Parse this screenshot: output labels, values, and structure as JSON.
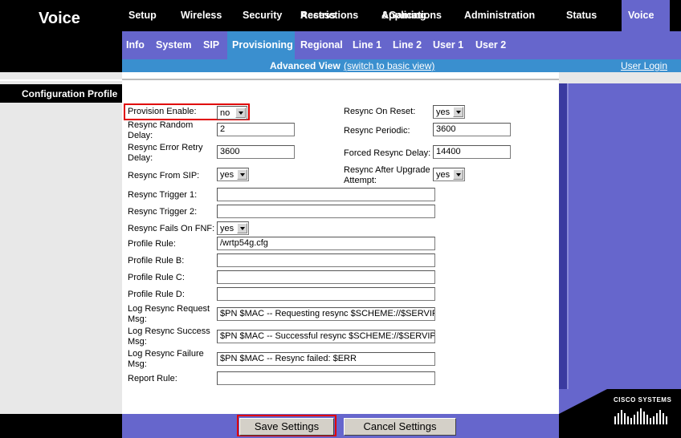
{
  "app": {
    "title": "Voice"
  },
  "main_nav": {
    "tabs": [
      {
        "label": "Setup"
      },
      {
        "label": "Wireless"
      },
      {
        "label": "Security"
      },
      {
        "label": "Access Restrictions",
        "line1": "Access",
        "line2": "Restrictions"
      },
      {
        "label": "Applications &Gaming",
        "line1": "Applications",
        "line2": "&Gaming"
      },
      {
        "label": "Administration"
      },
      {
        "label": "Status"
      },
      {
        "label": "Voice"
      }
    ],
    "active": "Voice"
  },
  "sub_nav": {
    "tabs": [
      "Info",
      "System",
      "SIP",
      "Provisioning",
      "Regional",
      "Line 1",
      "Line 2",
      "User 1",
      "User 2"
    ],
    "active": "Provisioning"
  },
  "view_bar": {
    "advanced_label": "Advanced View",
    "switch_link": "(switch to basic view)",
    "login_link": "User Login"
  },
  "section": {
    "title": "Configuration Profile"
  },
  "form": {
    "provision_enable": {
      "label": "Provision Enable:",
      "value": "no"
    },
    "resync_random_delay": {
      "label_line1": "Resync Random",
      "label_line2": "Delay:",
      "value": "2"
    },
    "resync_error_retry_delay": {
      "label_line1": "Resync Error Retry",
      "label_line2": "Delay:",
      "value": "3600"
    },
    "resync_from_sip": {
      "label": "Resync From SIP:",
      "value": "yes"
    },
    "resync_trigger_1": {
      "label": "Resync Trigger 1:",
      "value": ""
    },
    "resync_trigger_2": {
      "label": "Resync Trigger 2:",
      "value": ""
    },
    "resync_fails_on_fnf": {
      "label": "Resync Fails On FNF:",
      "value": "yes"
    },
    "profile_rule": {
      "label": "Profile Rule:",
      "value": "/wrtp54g.cfg"
    },
    "profile_rule_b": {
      "label": "Profile Rule B:",
      "value": ""
    },
    "profile_rule_c": {
      "label": "Profile Rule C:",
      "value": ""
    },
    "profile_rule_d": {
      "label": "Profile Rule D:",
      "value": ""
    },
    "log_resync_request_msg": {
      "label_line1": "Log Resync Request",
      "label_line2": "Msg:",
      "value": "$PN $MAC -- Requesting resync $SCHEME://$SERVIP:"
    },
    "log_resync_success_msg": {
      "label_line1": "Log Resync Success",
      "label_line2": "Msg:",
      "value": "$PN $MAC -- Successful resync $SCHEME://$SERVIP:"
    },
    "log_resync_failure_msg": {
      "label_line1": "Log Resync Failure",
      "label_line2": "Msg:",
      "value": "$PN $MAC -- Resync failed: $ERR"
    },
    "report_rule": {
      "label": "Report Rule:",
      "value": ""
    },
    "resync_on_reset": {
      "label": "Resync On Reset:",
      "value": "yes"
    },
    "resync_periodic": {
      "label": "Resync Periodic:",
      "value": "3600"
    },
    "forced_resync_delay": {
      "label": "Forced Resync Delay:",
      "value": "14400"
    },
    "resync_after_upgrade_attempt": {
      "label_line1": "Resync After Upgrade",
      "label_line2": "Attempt:",
      "value": "yes"
    }
  },
  "buttons": {
    "save": "Save Settings",
    "cancel": "Cancel Settings"
  },
  "branding": {
    "name": "CISCO SYSTEMS"
  },
  "colors": {
    "nav_black": "#000000",
    "subnav_purple": "#6666cc",
    "active_blue": "#3a8fcf",
    "highlight_red": "#e00000"
  }
}
